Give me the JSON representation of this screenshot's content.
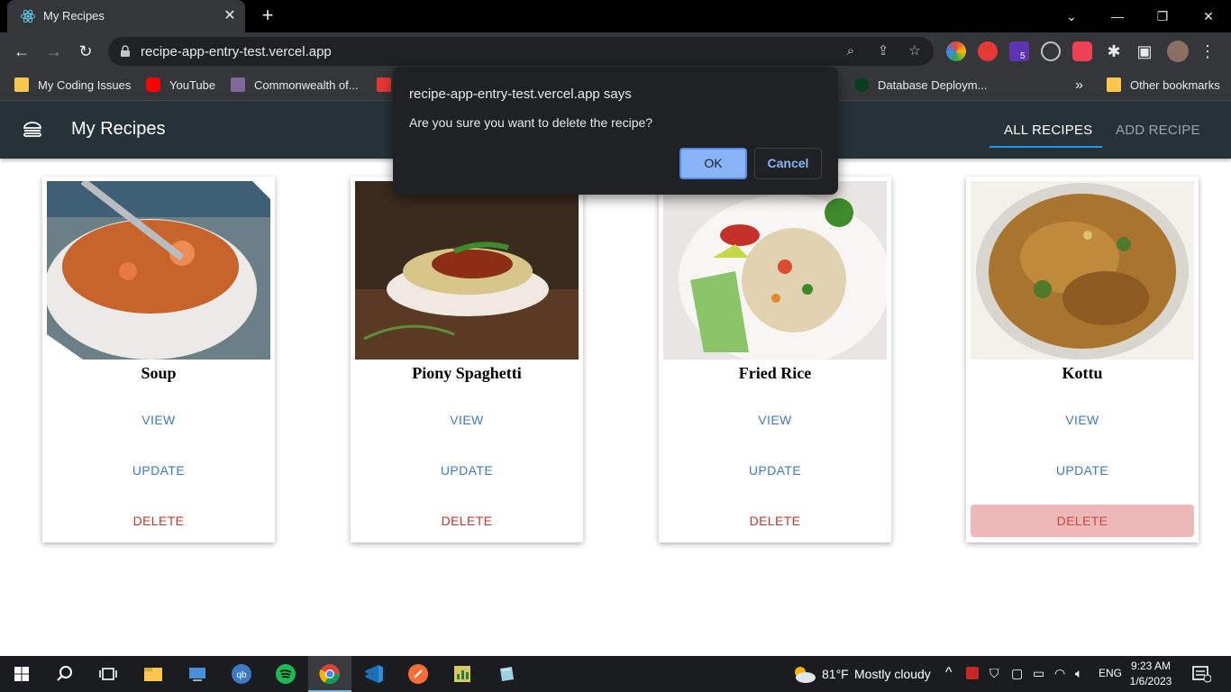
{
  "browser": {
    "tab_title": "My Recipes",
    "url": "recipe-app-entry-test.vercel.app",
    "extension_badge": "5",
    "bookmarks": [
      {
        "label": "My Coding Issues",
        "icon": "folder-icon"
      },
      {
        "label": "YouTube",
        "icon": "youtube-icon"
      },
      {
        "label": "Commonwealth of...",
        "icon": "commonwealth-icon"
      },
      {
        "label": "Database Deploym...",
        "icon": "mongodb-icon"
      }
    ],
    "bookmarks_overflow": "»",
    "other_bookmarks": "Other bookmarks"
  },
  "app": {
    "title": "My Recipes",
    "nav": {
      "all_recipes": "ALL RECIPES",
      "add_recipe": "ADD RECIPE"
    }
  },
  "recipes": [
    {
      "name": "Soup",
      "view": "VIEW",
      "update": "UPDATE",
      "delete": "DELETE"
    },
    {
      "name": "Piony Spaghetti",
      "view": "VIEW",
      "update": "UPDATE",
      "delete": "DELETE"
    },
    {
      "name": "Fried Rice",
      "view": "VIEW",
      "update": "UPDATE",
      "delete": "DELETE"
    },
    {
      "name": "Kottu",
      "view": "VIEW",
      "update": "UPDATE",
      "delete": "DELETE"
    }
  ],
  "dialog": {
    "title": "recipe-app-entry-test.vercel.app says",
    "message": "Are you sure you want to delete the recipe?",
    "ok": "OK",
    "cancel": "Cancel"
  },
  "taskbar": {
    "weather_temp": "81°F",
    "weather_text": "Mostly cloudy",
    "language": "ENG",
    "time": "9:23 AM",
    "date": "1/6/2023"
  },
  "colors": {
    "app_header": "#263238",
    "active_tab_underline": "#2196f3",
    "link_blue": "#3f7ac0",
    "delete_red": "#c0392b",
    "delete_hover_bg": "#efb8b8"
  }
}
